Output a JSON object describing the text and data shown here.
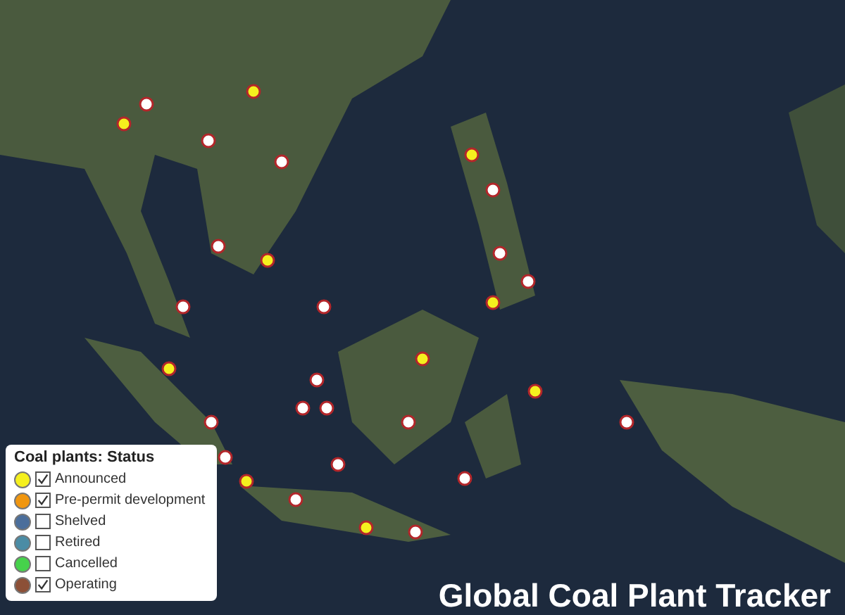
{
  "legend": {
    "title": "Coal plants: Status",
    "items": [
      {
        "label": "Announced",
        "color": "#f5f01e",
        "checked": true
      },
      {
        "label": "Pre-permit development",
        "color": "#f0960f",
        "checked": true
      },
      {
        "label": "Shelved",
        "color": "#4b6e9b",
        "checked": false
      },
      {
        "label": "Retired",
        "color": "#4b8ca5",
        "checked": false
      },
      {
        "label": "Cancelled",
        "color": "#46d24b",
        "checked": false
      },
      {
        "label": "Operating",
        "color": "#8c5037",
        "checked": true
      }
    ]
  },
  "title": "Global Coal Plant Tracker"
}
